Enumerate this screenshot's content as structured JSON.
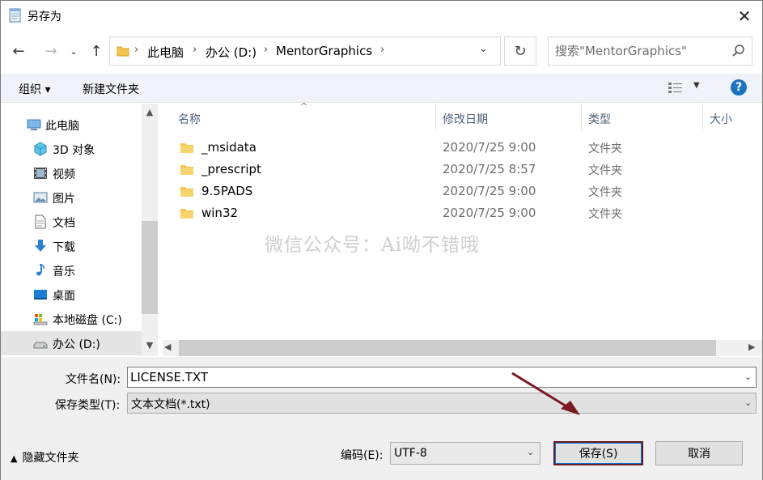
{
  "window": {
    "title": "另存为"
  },
  "address": {
    "crumbs": [
      "此电脑",
      "办公 (D:)",
      "MentorGraphics"
    ],
    "search_placeholder": "搜索\"MentorGraphics\""
  },
  "toolbar": {
    "organize": "组织 ▾",
    "new_folder": "新建文件夹",
    "help": "?"
  },
  "nav": {
    "items": [
      {
        "label": "此电脑",
        "icon": "computer-icon"
      },
      {
        "label": "3D 对象",
        "icon": "cube-icon"
      },
      {
        "label": "视频",
        "icon": "video-icon"
      },
      {
        "label": "图片",
        "icon": "picture-icon"
      },
      {
        "label": "文档",
        "icon": "document-icon"
      },
      {
        "label": "下载",
        "icon": "download-icon"
      },
      {
        "label": "音乐",
        "icon": "music-icon"
      },
      {
        "label": "桌面",
        "icon": "desktop-icon"
      },
      {
        "label": "本地磁盘 (C:)",
        "icon": "drive-c-icon"
      },
      {
        "label": "办公 (D:)",
        "icon": "drive-d-icon"
      }
    ],
    "selected": "办公 (D:)"
  },
  "columns": {
    "name": "名称",
    "modified": "修改日期",
    "type": "类型",
    "size": "大小"
  },
  "files": [
    {
      "name": "_msidata",
      "modified": "2020/7/25 9:00",
      "type": "文件夹"
    },
    {
      "name": "_prescript",
      "modified": "2020/7/25 8:57",
      "type": "文件夹"
    },
    {
      "name": "9.5PADS",
      "modified": "2020/7/25 9:00",
      "type": "文件夹"
    },
    {
      "name": "win32",
      "modified": "2020/7/25 9:00",
      "type": "文件夹"
    }
  ],
  "watermark": "微信公众号：Ai呦不错哦",
  "form": {
    "filename_label": "文件名(N):",
    "filename_value": "LICENSE.TXT",
    "savetype_label": "保存类型(T):",
    "savetype_value": "文本文档(*.txt)",
    "hide_folders": "隐藏文件夹",
    "encoding_label": "编码(E):",
    "encoding_value": "UTF-8",
    "save_button": "保存(S)",
    "cancel_button": "取消"
  },
  "colors": {
    "folder": "#f3c44f",
    "help": "#1e73be",
    "annotation_arrow": "#7a1a22",
    "selection": "#e5e5e5"
  }
}
